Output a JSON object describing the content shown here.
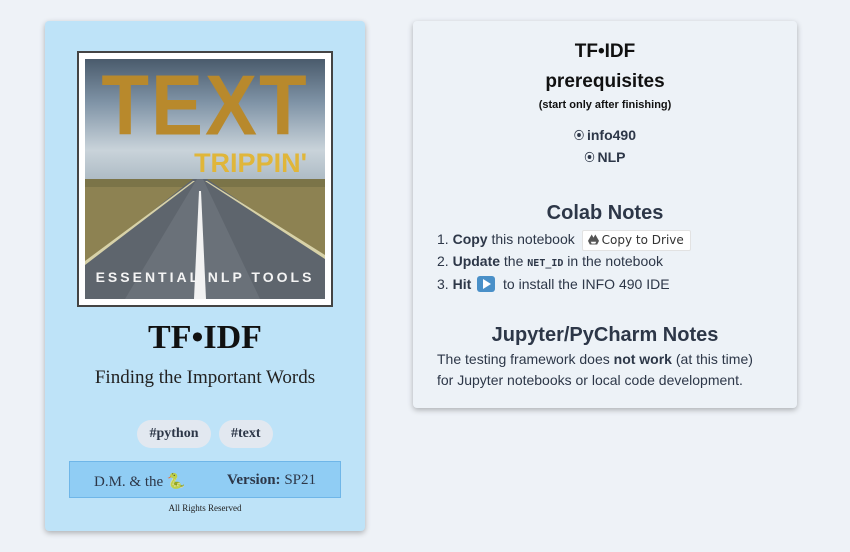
{
  "cover": {
    "title": "TEXT",
    "subtitle": "TRIPPIN'",
    "tagline": "ESSENTIAL NLP TOOLS",
    "colors": {
      "title": "#b8892c",
      "subtitle": "#e0b63a"
    }
  },
  "left_card": {
    "title": "TF•IDF",
    "subtitle": "Finding the Important Words",
    "tags": [
      "#python",
      "#text"
    ],
    "footer": {
      "author": "D.M. & the 🐍",
      "version_label": "Version:",
      "version_value": "SP21"
    },
    "rights": "All Rights Reserved",
    "colors": {
      "background": "#bee3f8",
      "footer": "#90cdf4"
    }
  },
  "right_card": {
    "title": "TF•IDF",
    "prereq_heading": "prerequisites",
    "prereq_note": "(start only after finishing)",
    "prereqs": [
      "info490",
      "NLP"
    ],
    "colab": {
      "heading": "Colab Notes",
      "step1": {
        "num": "1.",
        "bold": "Copy",
        "text": "this notebook",
        "button": "Copy to Drive"
      },
      "step2": {
        "num": "2.",
        "bold": "Update",
        "text_a": "the",
        "code": "NET_ID",
        "text_b": "in the notebook"
      },
      "step3": {
        "num": "3.",
        "bold": "Hit",
        "text": "to install the INFO 490 IDE"
      }
    },
    "jupyter": {
      "heading": "Jupyter/PyCharm Notes",
      "line1_a": "The testing framework does",
      "line1_bold": "not work",
      "line1_b": "(at this time)",
      "line2": "for Jupyter notebooks or local code development."
    },
    "icons": {
      "prereq_bullet": "radio-bullet-icon",
      "drive": "google-drive-icon",
      "run": "play-button-icon"
    }
  }
}
